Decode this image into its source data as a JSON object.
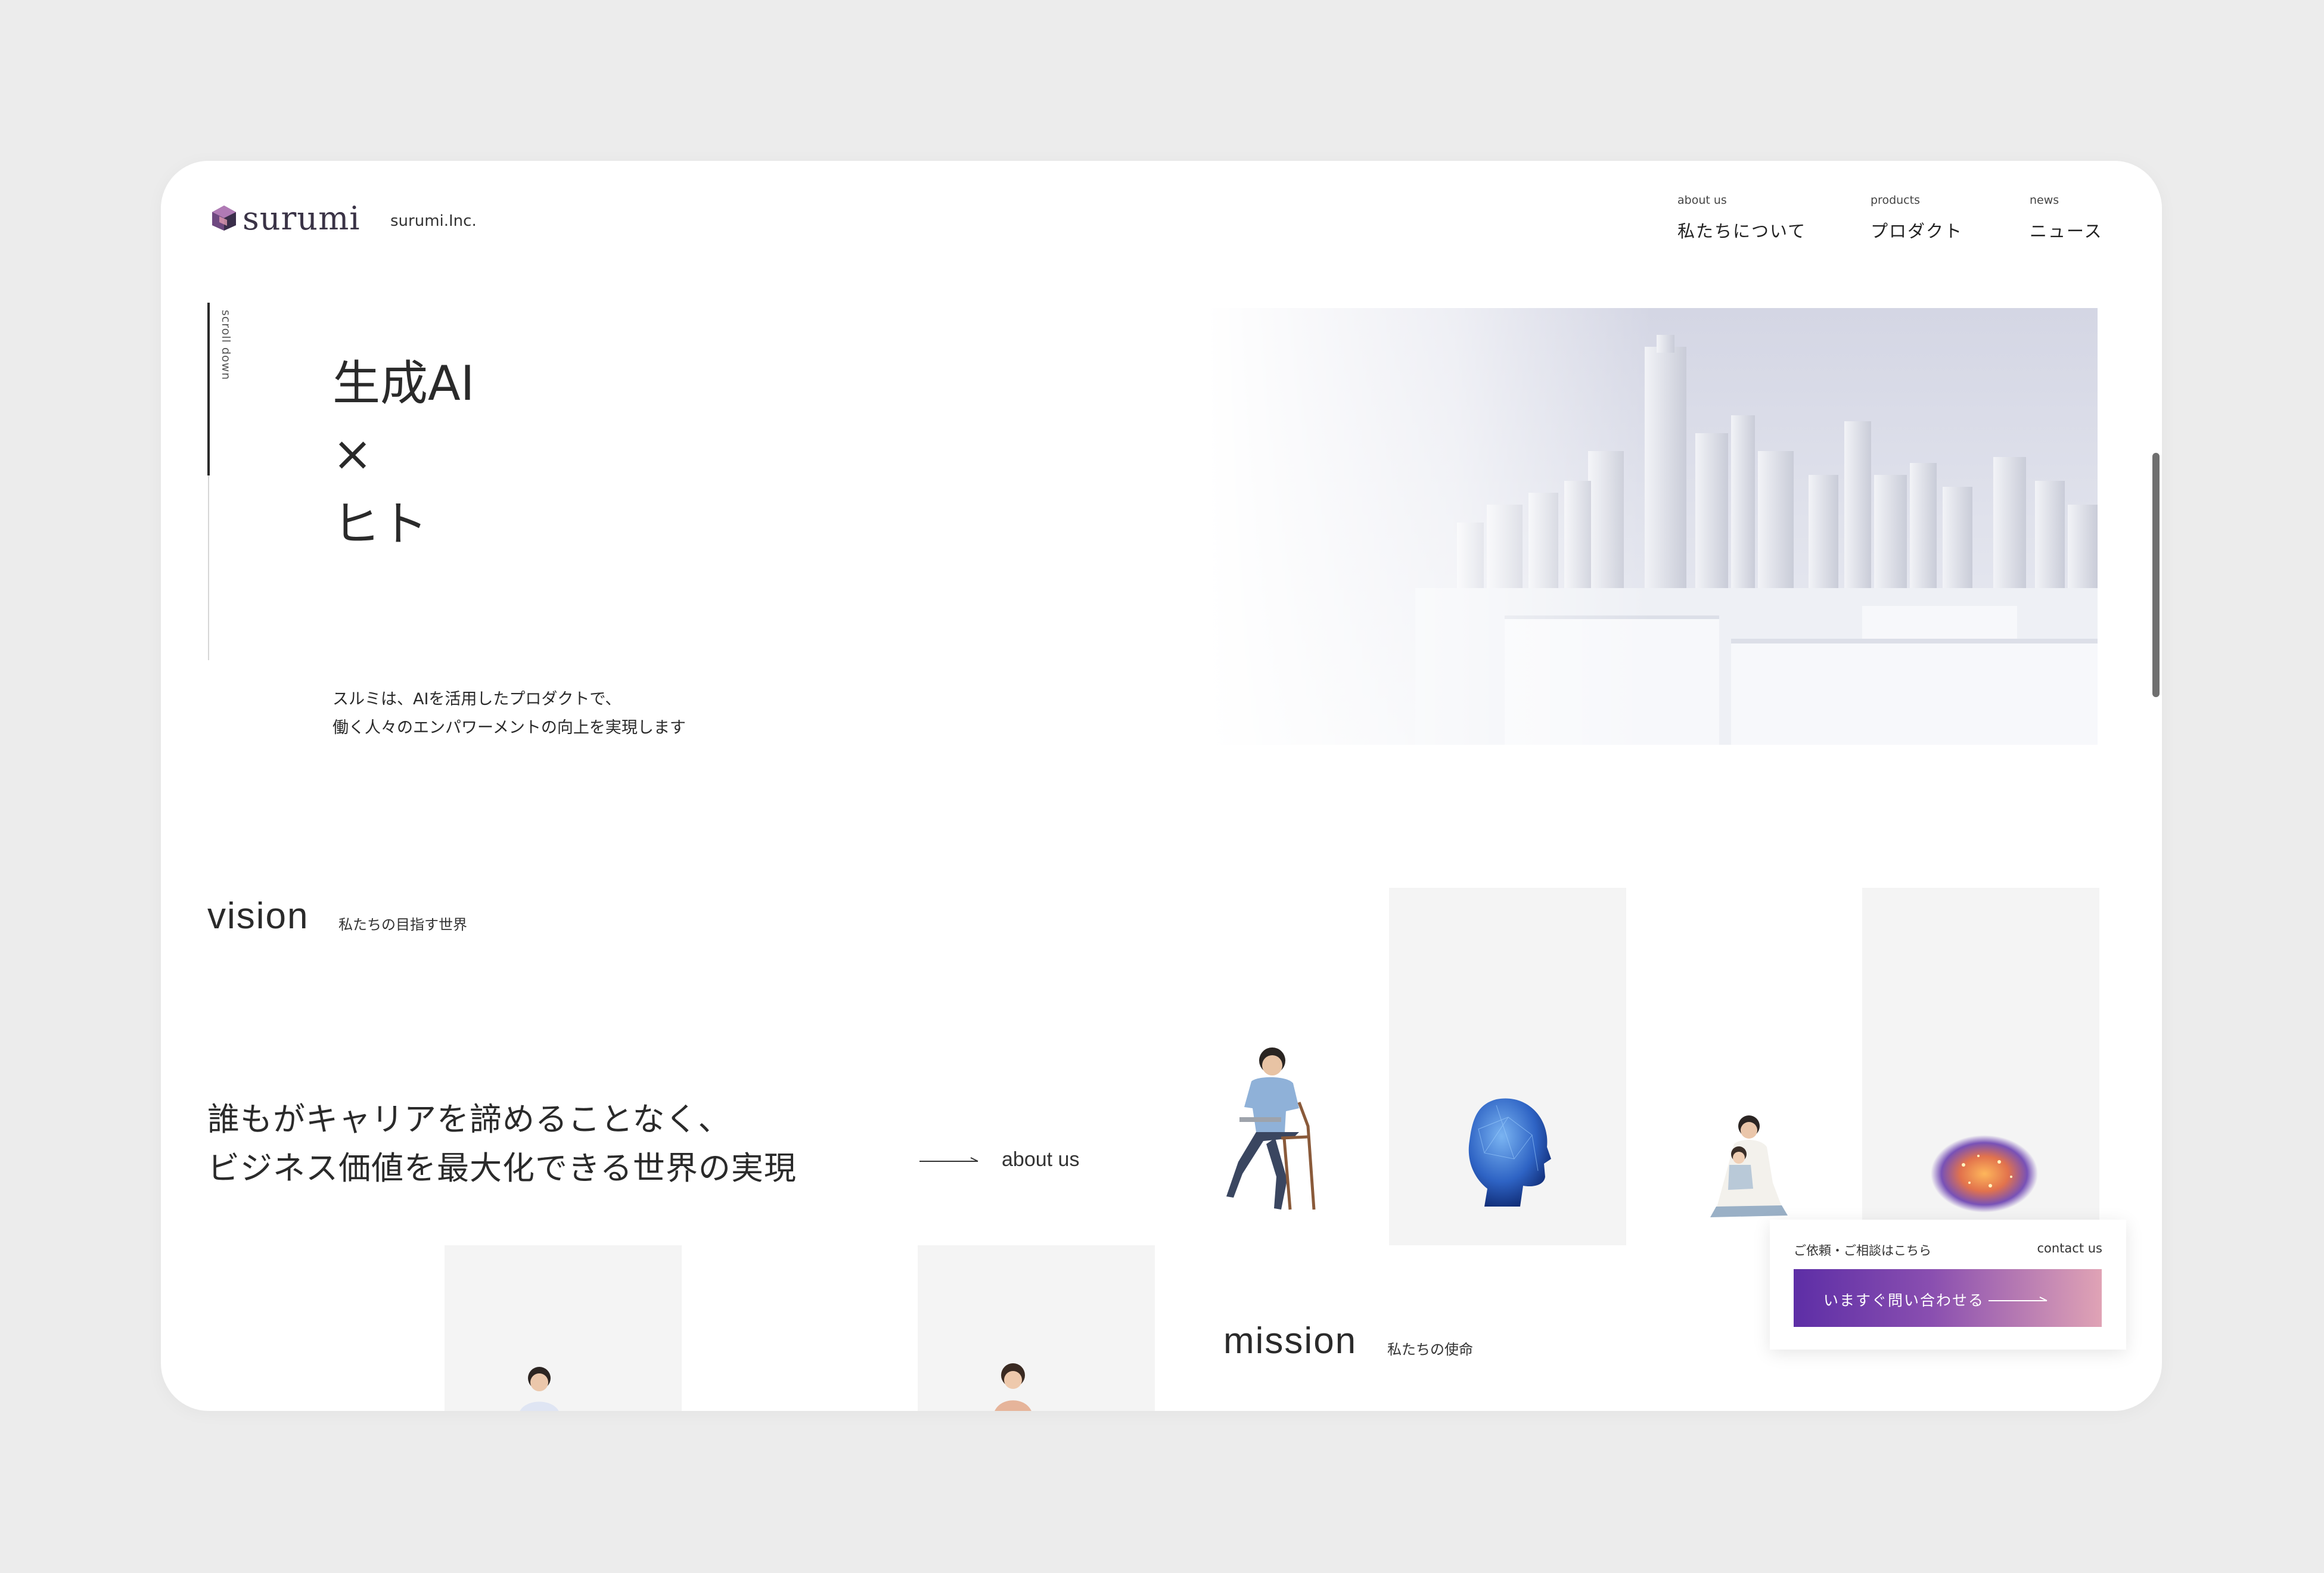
{
  "brand": {
    "logo_text": "surumi",
    "company": "surumi.Inc."
  },
  "nav": [
    {
      "en": "about us",
      "jp": "私たちについて"
    },
    {
      "en": "products",
      "jp": "プロダクト"
    },
    {
      "en": "news",
      "jp": "ニュース"
    }
  ],
  "hero": {
    "scroll_label": "scroll down",
    "title_lines": [
      "生成AI",
      "×",
      "ヒト"
    ],
    "sub_lines": [
      "スルミは、AIを活用したプロダクトで、",
      "働く人々のエンパワーメントの向上を実現します"
    ]
  },
  "vision": {
    "title": "vision",
    "subtitle": "私たちの目指す世界",
    "text_lines": [
      "誰もがキャリアを諦めることなく、",
      "ビジネス価値を最大化できる世界の実現"
    ],
    "link_label": "about us"
  },
  "mission": {
    "title": "mission",
    "subtitle": "私たちの使命"
  },
  "contact": {
    "label": "ご依頼・ご相談はこちら",
    "label_en": "contact us",
    "button_label": "いますぐ問い合わせる"
  },
  "colors": {
    "accent_start": "#5d2ea6",
    "accent_end": "#e0a3b5",
    "logo": "#8a5a9a"
  }
}
